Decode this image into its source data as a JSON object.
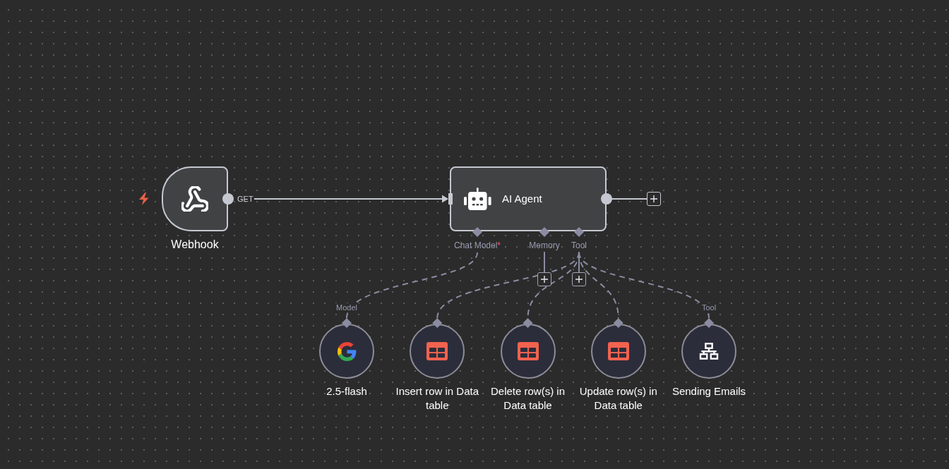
{
  "workflow": {
    "trigger": {
      "kind": "webhook",
      "label": "Webhook",
      "output_label": "GET"
    },
    "agent": {
      "kind": "agent",
      "label": "AI Agent",
      "output_add_button": true,
      "inputs": [
        {
          "label": "Chat Model",
          "required_mark": "*",
          "nodes": [
            {
              "kind": "google",
              "label": "2.5-flash",
              "handle_label": "Model"
            }
          ]
        },
        {
          "label": "Memory",
          "add_button": true
        },
        {
          "label": "Tool",
          "add_button": true,
          "nodes": [
            {
              "kind": "datatable",
              "label": "Insert row in Data table"
            },
            {
              "kind": "datatable",
              "label": "Delete row(s) in Data table"
            },
            {
              "kind": "datatable",
              "label": "Update row(s) in Data table"
            },
            {
              "kind": "network",
              "label": "Sending Emails",
              "handle_label": "Tool"
            }
          ]
        }
      ]
    }
  }
}
